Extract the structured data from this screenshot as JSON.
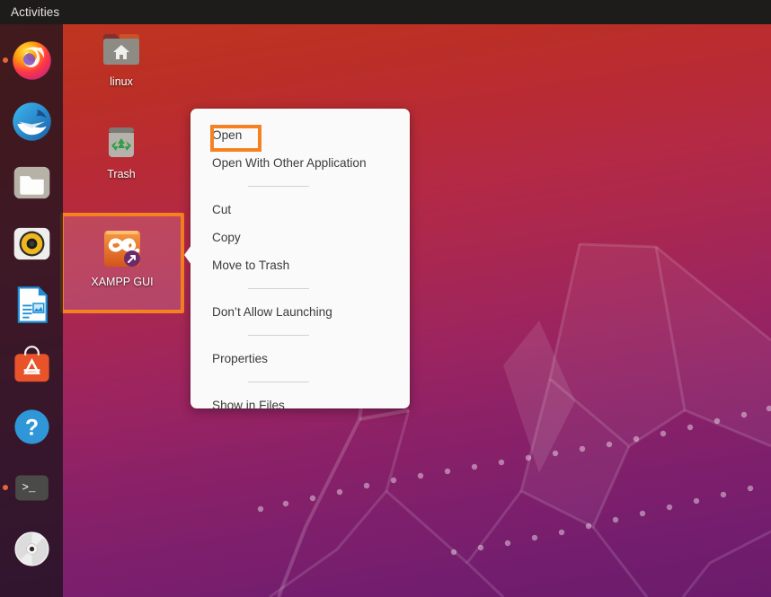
{
  "topbar": {
    "activities_label": "Activities"
  },
  "dock": {
    "items": [
      {
        "name": "firefox",
        "label": "Firefox Web Browser",
        "running": true
      },
      {
        "name": "thunderbird",
        "label": "Thunderbird Mail",
        "running": false
      },
      {
        "name": "files",
        "label": "Files",
        "running": false
      },
      {
        "name": "rhythmbox",
        "label": "Rhythmbox",
        "running": false
      },
      {
        "name": "libreoffice",
        "label": "LibreOffice Writer",
        "running": false
      },
      {
        "name": "software",
        "label": "Ubuntu Software",
        "running": false
      },
      {
        "name": "help",
        "label": "Help",
        "running": false
      },
      {
        "name": "terminal",
        "label": "Terminal",
        "running": true
      },
      {
        "name": "disc",
        "label": "Disc Image",
        "running": false
      }
    ]
  },
  "desktop": {
    "icons": [
      {
        "name": "linux",
        "label": "linux"
      },
      {
        "name": "trash",
        "label": "Trash"
      },
      {
        "name": "xampp-gui",
        "label": "XAMPP GUI",
        "selected": true
      }
    ]
  },
  "context_menu": {
    "items": [
      {
        "label": "Open",
        "highlighted": true
      },
      {
        "label": "Open With Other Application"
      },
      {
        "separator": true
      },
      {
        "label": "Cut"
      },
      {
        "label": "Copy"
      },
      {
        "label": "Move to Trash"
      },
      {
        "separator": true
      },
      {
        "label": "Don’t Allow Launching"
      },
      {
        "separator": true
      },
      {
        "label": "Properties"
      },
      {
        "separator": true
      },
      {
        "label": "Show in Files"
      }
    ]
  },
  "colors": {
    "annotation": "#f68121",
    "topbar": "#1d1c1b",
    "menu_bg": "#fafafa",
    "wallpaper_top": "#c0361e",
    "wallpaper_bottom": "#6b1b6c"
  }
}
